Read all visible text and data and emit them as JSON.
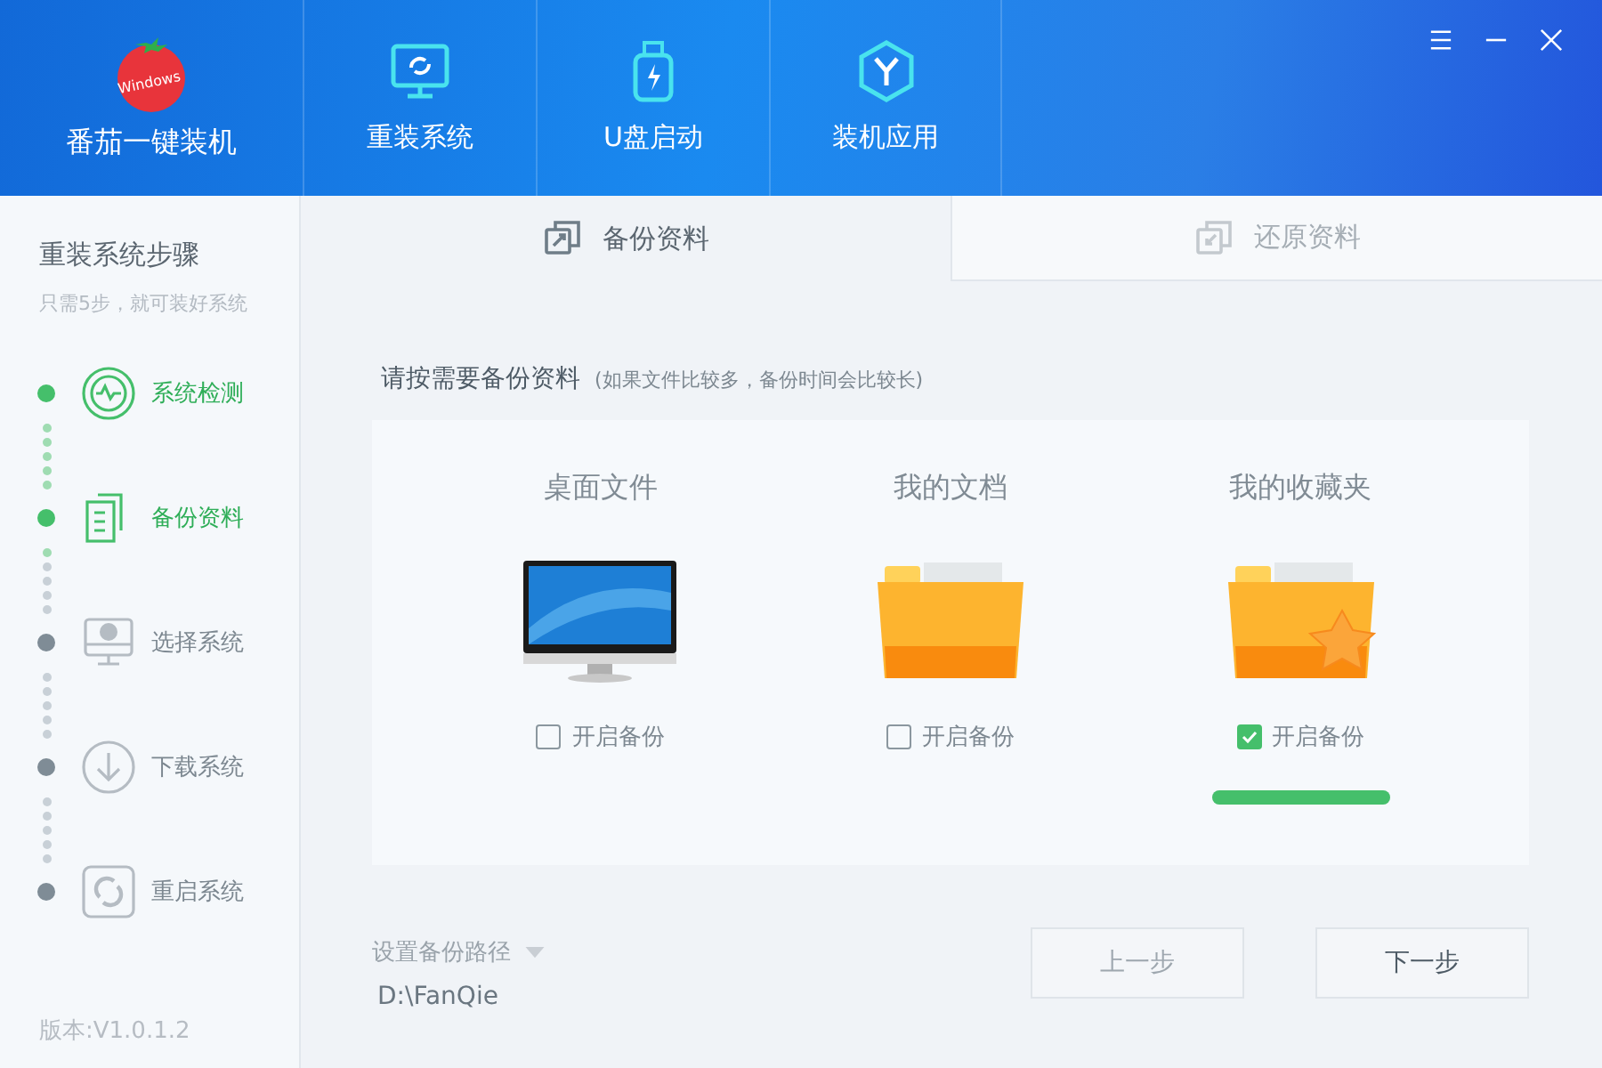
{
  "app": {
    "name": "番茄一键装机",
    "logo_text": "Windows"
  },
  "nav": [
    {
      "label": "重装系统"
    },
    {
      "label": "U盘启动"
    },
    {
      "label": "装机应用"
    }
  ],
  "sidebar": {
    "title": "重装系统步骤",
    "subtitle": "只需5步，就可装好系统",
    "version": "版本:V1.0.1.2",
    "steps": [
      {
        "label": "系统检测",
        "active": true
      },
      {
        "label": "备份资料",
        "active": true
      },
      {
        "label": "选择系统",
        "active": false
      },
      {
        "label": "下载系统",
        "active": false
      },
      {
        "label": "重启系统",
        "active": false
      }
    ]
  },
  "tabs": [
    {
      "label": "备份资料",
      "selected": true
    },
    {
      "label": "还原资料",
      "selected": false
    }
  ],
  "heading": "请按需要备份资料",
  "hint": "(如果文件比较多，备份时间会比较长)",
  "items": [
    {
      "title": "桌面文件",
      "kind": "monitor",
      "checkbox": "开启备份",
      "checked": false
    },
    {
      "title": "我的文档",
      "kind": "folder",
      "checkbox": "开启备份",
      "checked": false
    },
    {
      "title": "我的收藏夹",
      "kind": "star-folder",
      "checkbox": "开启备份",
      "checked": true,
      "level": 1
    }
  ],
  "path_label": "设置备份路径",
  "path": "D:\\FanQie",
  "buttons": [
    {
      "label": "上一步",
      "disabled": true
    },
    {
      "label": "下一步",
      "disabled": false
    }
  ]
}
